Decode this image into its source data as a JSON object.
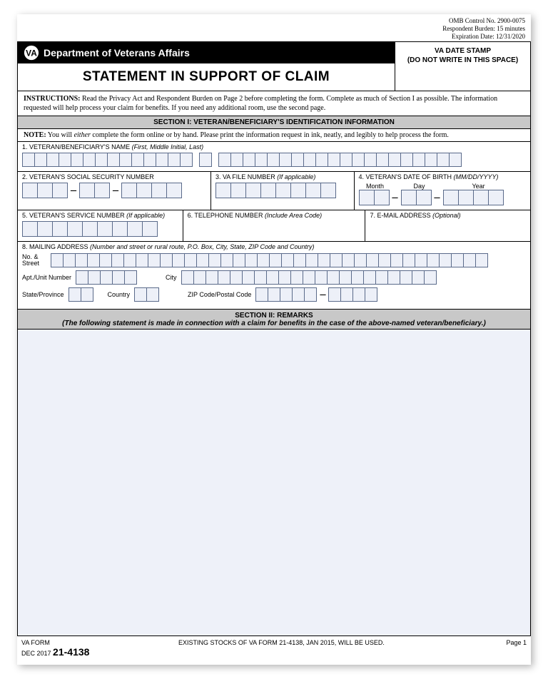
{
  "meta": {
    "omb": "OMB Control No. 2900-0075",
    "burden": "Respondent Burden: 15 minutes",
    "expiration": "Expiration Date: 12/31/2020"
  },
  "header": {
    "agency": "Department of Veterans Affairs",
    "title": "STATEMENT IN SUPPORT OF CLAIM",
    "date_stamp_line1": "VA DATE STAMP",
    "date_stamp_line2": "(DO NOT WRITE IN THIS SPACE)"
  },
  "instructions": {
    "label": "INSTRUCTIONS:",
    "text": " Read the Privacy Act and Respondent Burden on Page 2 before completing the form.  Complete as much of Section I as possible.  The information requested will help process your claim for benefits.  If you need any additional room, use the second page."
  },
  "section1": {
    "heading": "SECTION I:  VETERAN/BENEFICIARY'S IDENTIFICATION INFORMATION",
    "note_label": "NOTE:",
    "note_text": "  You will ",
    "note_italic": "either",
    "note_rest": " complete the form online or by hand.  Please print the information request in ink, neatly, and legibly to help process the form.",
    "f1_label": "1. VETERAN/BENEFICIARY'S NAME ",
    "f1_italic": "(First, Middle Initial, Last)",
    "f2_label": "2. VETERAN'S SOCIAL SECURITY NUMBER",
    "f3_label": "3. VA FILE NUMBER ",
    "f3_italic": "(If applicable)",
    "f4_label": "4. VETERAN'S DATE OF BIRTH ",
    "f4_italic": "(MM/DD/YYYY)",
    "f4_month": "Month",
    "f4_day": "Day",
    "f4_year": "Year",
    "f5_label": "5. VETERAN'S SERVICE NUMBER ",
    "f5_italic": "(If applicable)",
    "f6_label": "6. TELEPHONE NUMBER ",
    "f6_italic": "(Include Area Code)",
    "f7_label": "7. E-MAIL ADDRESS ",
    "f7_italic": "(Optional)",
    "f8_label": "8. MAILING ADDRESS ",
    "f8_italic": "(Number and street or rural route, P.O. Box, City, State, ZIP Code and Country)",
    "addr_no_street": "No. & Street",
    "addr_apt": "Apt./Unit Number",
    "addr_city": "City",
    "addr_state": "State/Province",
    "addr_country": "Country",
    "addr_zip": "ZIP Code/Postal Code"
  },
  "section2": {
    "heading": "SECTION II:  REMARKS",
    "subtitle": "(The following statement is made in connection with a claim for benefits in the case of the above-named veteran/beneficiary.)"
  },
  "footer": {
    "va_form": "VA FORM",
    "date": "DEC 2017",
    "number": "21-4138",
    "center": "EXISTING STOCKS OF VA FORM 21-4138, JAN 2015, WILL BE USED.",
    "page": "Page 1"
  }
}
